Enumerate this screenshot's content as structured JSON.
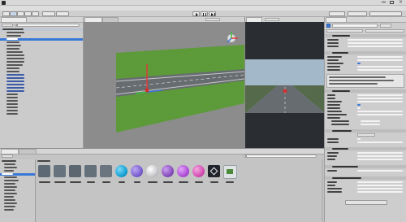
{
  "window": {
    "title": "",
    "icon": "unity-logo-icon"
  },
  "menubar": {
    "items": [
      "",
      "",
      "",
      "",
      "",
      "",
      "",
      ""
    ]
  },
  "toolbar": {
    "tools": [
      "hand-tool-icon",
      "move-tool-icon",
      "rotate-tool-icon",
      "scale-tool-icon",
      "rect-tool-icon"
    ],
    "pivot_label": "",
    "space_label": "",
    "play": "play-icon",
    "pause": "pause-icon",
    "step": "step-icon",
    "account_label": "",
    "layers_label": "",
    "layout_label": ""
  },
  "hierarchy": {
    "tab_label": "",
    "create_label": "",
    "search_placeholder": "",
    "items": [
      "",
      "",
      "",
      "",
      "",
      "",
      "",
      "",
      "",
      "",
      "",
      "",
      "",
      "",
      "",
      "",
      "",
      "",
      "",
      "",
      "",
      "",
      "",
      "",
      "",
      "",
      ""
    ]
  },
  "scene": {
    "tab_label": "",
    "game_tab_label": "",
    "gizmos_label": ""
  },
  "game": {
    "tab_label": "",
    "display_label": ""
  },
  "inspector": {
    "tab_label": "",
    "object_name": "",
    "tag_label": "",
    "layer_label": "",
    "components": [
      {
        "title": "",
        "rows": 4
      },
      {
        "title": "",
        "rows": 6
      },
      {
        "title": "",
        "rows": 11
      },
      {
        "title": "",
        "rows": 4
      },
      {
        "title": "",
        "rows": 4
      },
      {
        "title": "",
        "rows": 2
      },
      {
        "title": "",
        "rows": 5
      }
    ],
    "add_component_label": ""
  },
  "project": {
    "tab_label": "",
    "console_tab_label": "",
    "create_label": "",
    "search_placeholder": "",
    "breadcrumb": "",
    "tree": [
      "",
      "",
      "",
      "",
      "",
      "",
      "",
      "",
      "",
      "",
      "",
      "",
      "",
      "",
      "",
      ""
    ],
    "assets": [
      {
        "name": "",
        "kind": "folder",
        "color": "#5d6a75"
      },
      {
        "name": "",
        "kind": "folder",
        "color": "#66727d"
      },
      {
        "name": "",
        "kind": "folder",
        "color": "#5b6670"
      },
      {
        "name": "",
        "kind": "folder",
        "color": "#64707a"
      },
      {
        "name": "",
        "kind": "folder",
        "color": "#6a757f"
      },
      {
        "name": "",
        "kind": "material",
        "color": "#18a3d6"
      },
      {
        "name": "",
        "kind": "material",
        "color": "#7b5fd1"
      },
      {
        "name": "",
        "kind": "material",
        "color": "#c9c9cf"
      },
      {
        "name": "",
        "kind": "material",
        "color": "#8a4fbf"
      },
      {
        "name": "",
        "kind": "material",
        "color": "#b04ed8"
      },
      {
        "name": "",
        "kind": "material",
        "color": "#d64fb4"
      },
      {
        "name": "",
        "kind": "prefab",
        "color": "#20232a"
      },
      {
        "name": "",
        "kind": "script",
        "color": "#dfe3e6"
      }
    ]
  },
  "colors": {
    "accent": "#3a78d8",
    "grass": "#5d9a3a",
    "road": "#676c70",
    "sky": "#a3b8c8"
  }
}
